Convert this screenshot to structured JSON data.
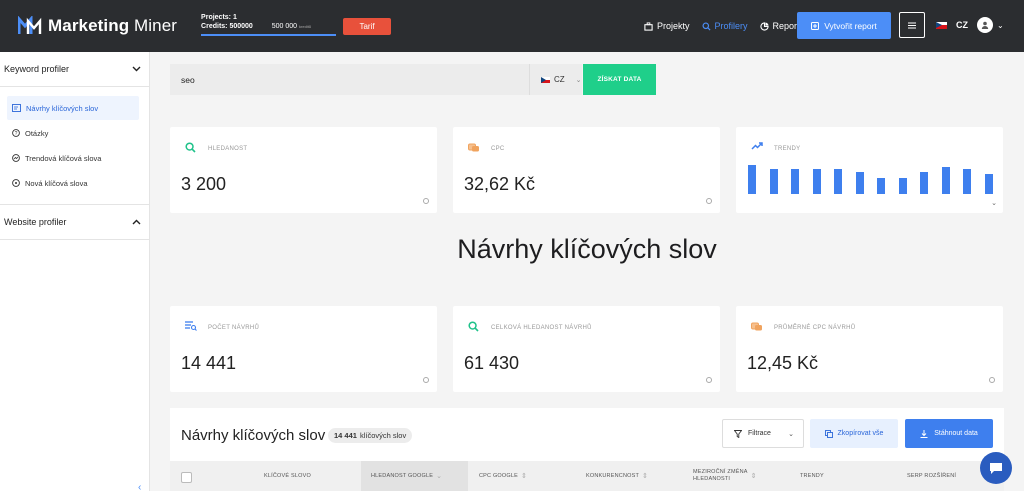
{
  "app": {
    "name_bold": "Marketing",
    "name_light": " Miner"
  },
  "header": {
    "projects_label": "Projects: 1",
    "credits_label": "Credits: 500000",
    "credits_amount": "500 000",
    "credits_amount_suffix": "kreditů",
    "credits_fraction": 1.0,
    "tariff_button": "Tarif",
    "nav": [
      {
        "label": "Projekty",
        "icon": "briefcase-icon",
        "active": false
      },
      {
        "label": "Profilery",
        "icon": "search-icon",
        "active": true
      },
      {
        "label": "Reporty",
        "icon": "pie-chart-icon",
        "active": false
      }
    ],
    "create_report_button": "Vytvořit report",
    "menu_icon": "hamburger-icon",
    "language": "CZ"
  },
  "sidebar": {
    "sections": [
      {
        "title": "Keyword profiler",
        "expanded": true,
        "items": [
          {
            "label": "Návrhy klíčových slov",
            "icon": "suggestions-icon",
            "active": true
          },
          {
            "label": "Otázky",
            "icon": "question-icon",
            "active": false
          },
          {
            "label": "Trendová klíčová slova",
            "icon": "trend-icon",
            "active": false
          },
          {
            "label": "Nová klíčová slova",
            "icon": "new-icon",
            "active": false
          }
        ]
      },
      {
        "title": "Website profiler",
        "expanded": false,
        "items": []
      }
    ]
  },
  "search": {
    "value": "seo",
    "country": "CZ",
    "submit_button": "ZÍSKAT DATA"
  },
  "stats_top": [
    {
      "label": "HLEDANOST",
      "value": "3 200",
      "icon": "search-icon",
      "color": "#1fc28a"
    },
    {
      "label": "CPC",
      "value": "32,62 Kč",
      "icon": "coins-icon",
      "color": "#f0a35e"
    },
    {
      "label": "TRENDY",
      "icon": "trend-up-icon",
      "color": "#3e7fee"
    }
  ],
  "trends": [
    0.92,
    0.8,
    0.8,
    0.8,
    0.8,
    0.72,
    0.52,
    0.52,
    0.72,
    0.86,
    0.8,
    0.66
  ],
  "page_title": "Návrhy klíčových slov",
  "stats_bottom": [
    {
      "label": "POČET NÁVRHŮ",
      "value": "14 441",
      "icon": "list-icon",
      "color": "#3e7fee"
    },
    {
      "label": "CELKOVÁ HLEDANOST NÁVRHŮ",
      "value": "61 430",
      "icon": "search-icon",
      "color": "#1fc28a"
    },
    {
      "label": "PRŮMĚRNÉ CPC NÁVRHŮ",
      "value": "12,45 Kč",
      "icon": "coins-icon",
      "color": "#f0a35e"
    }
  ],
  "table": {
    "title": "Návrhy klíčových slov",
    "count": "14 441",
    "count_suffix": "klíčových slov",
    "filter_button": "Filtrace",
    "copy_button": "Zkopírovat vše",
    "download_button": "Stáhnout data",
    "columns": [
      {
        "label": "KLÍČOVÉ SLOVO",
        "sortable": false,
        "sorted": false
      },
      {
        "label": "HLEDANOST GOOGLE",
        "sortable": true,
        "sorted": true
      },
      {
        "label": "CPC GOOGLE",
        "sortable": true,
        "sorted": false
      },
      {
        "label": "KONKURENCNOST",
        "sortable": true,
        "sorted": false
      },
      {
        "label": "MEZIROČNÍ ZMĚNA",
        "label2": "HLEDANOSTI",
        "sortable": true,
        "sorted": false
      },
      {
        "label": "TRENDY",
        "sortable": false,
        "sorted": false
      },
      {
        "label": "SERP ROZŠÍŘENÍ",
        "sortable": false,
        "sorted": false
      }
    ]
  },
  "colors": {
    "topbar": "#2b2d30",
    "accent": "#3e7fee",
    "green": "#1fcf8a",
    "tariff": "#e8513b"
  }
}
